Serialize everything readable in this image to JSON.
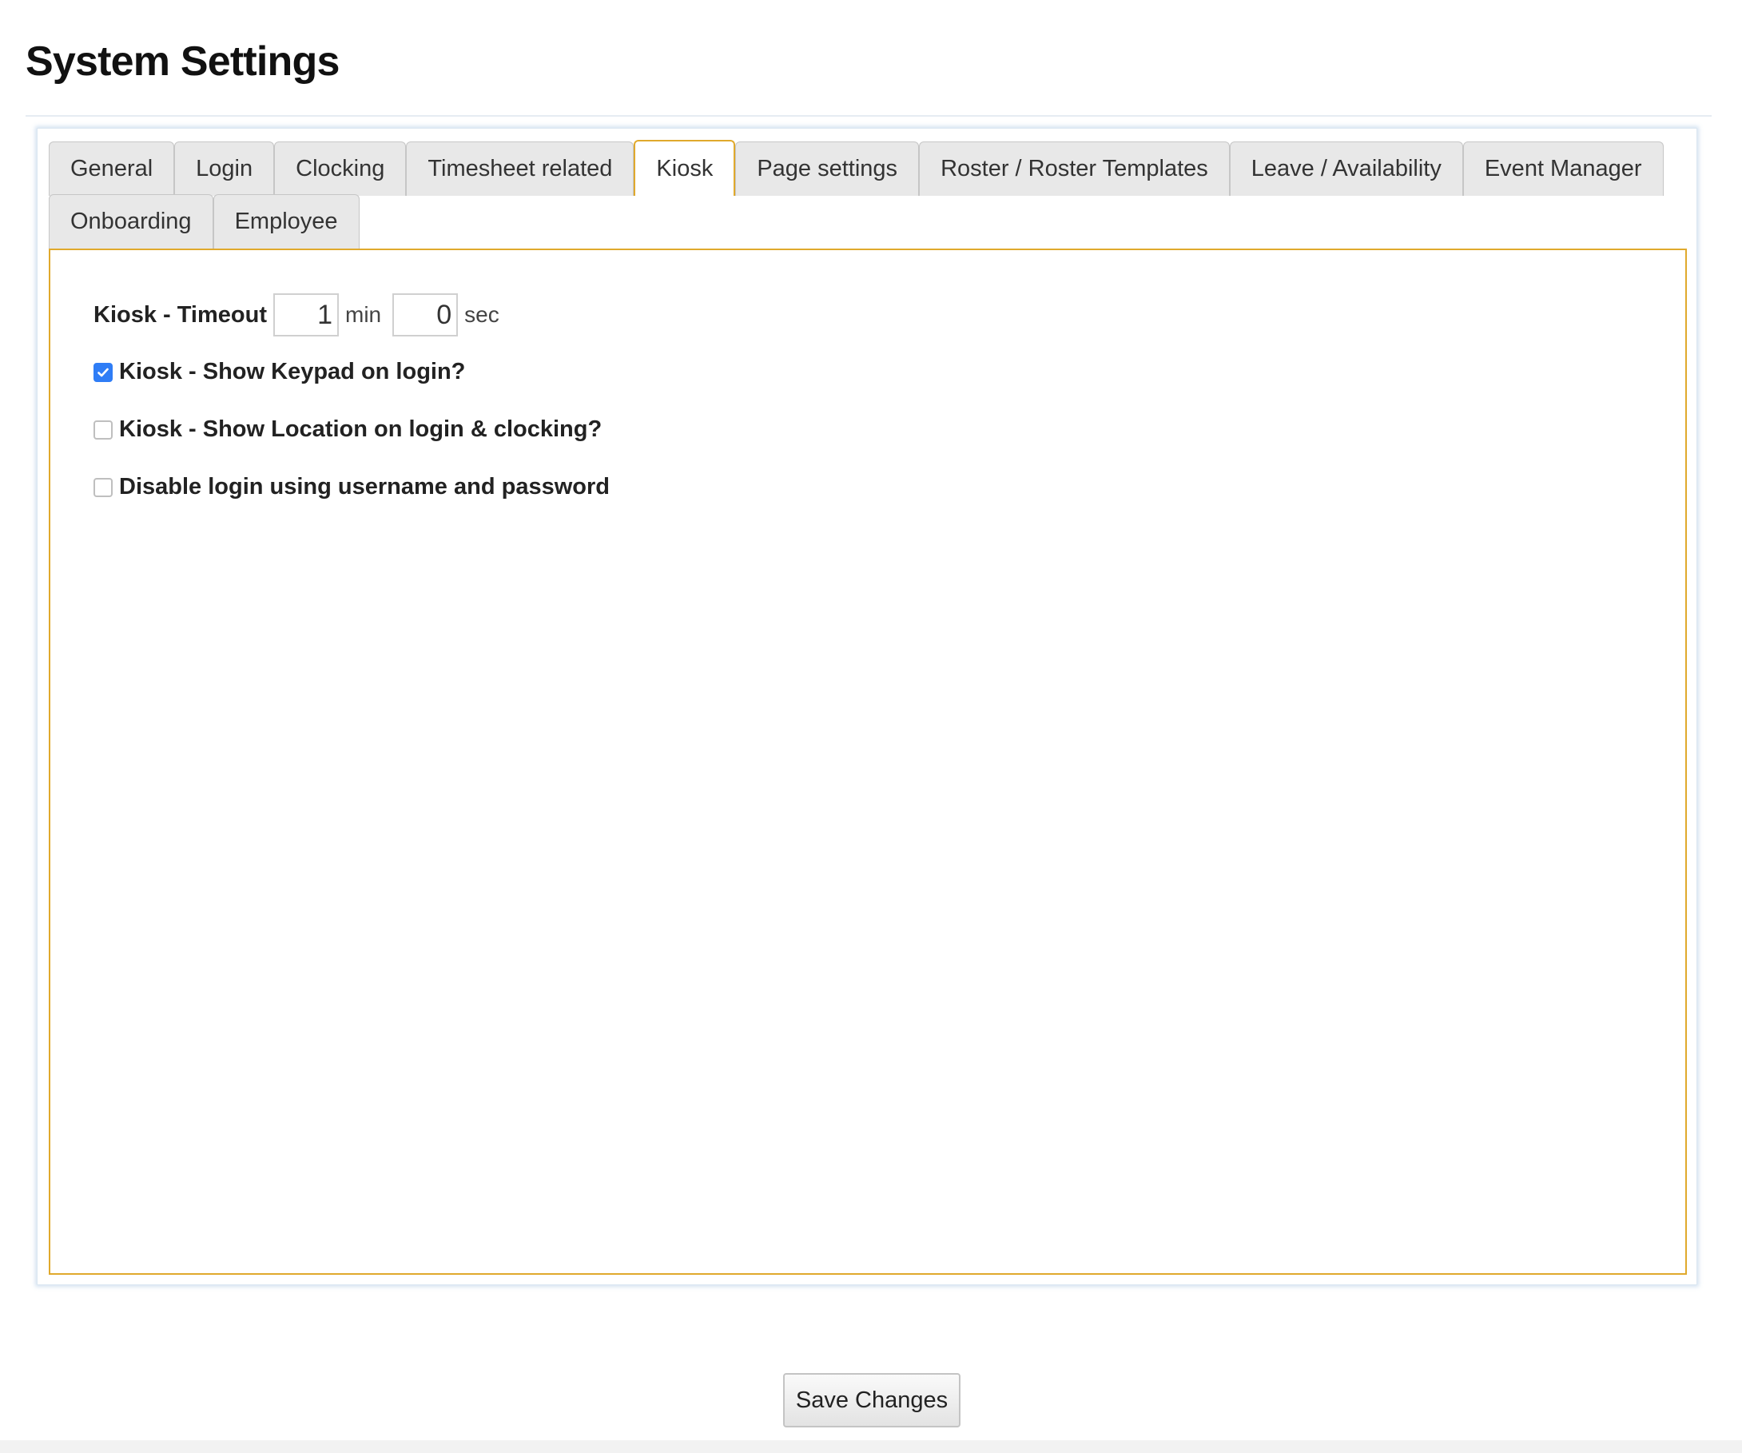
{
  "page": {
    "title": "System Settings"
  },
  "tabs": {
    "row1": [
      {
        "label": "General",
        "active": false
      },
      {
        "label": "Login",
        "active": false
      },
      {
        "label": "Clocking",
        "active": false
      },
      {
        "label": "Timesheet related",
        "active": false
      },
      {
        "label": "Kiosk",
        "active": true
      },
      {
        "label": "Page settings",
        "active": false
      },
      {
        "label": "Roster / Roster Templates",
        "active": false
      },
      {
        "label": "Leave / Availability",
        "active": false
      },
      {
        "label": "Event Manager",
        "active": false
      }
    ],
    "row2": [
      {
        "label": "Onboarding",
        "active": false
      },
      {
        "label": "Employee",
        "active": false
      }
    ]
  },
  "kiosk": {
    "timeout": {
      "label": "Kiosk - Timeout",
      "minutes": "1",
      "min_unit": "min",
      "seconds": "0",
      "sec_unit": "sec"
    },
    "show_keypad": {
      "label": "Kiosk - Show Keypad on login?",
      "checked": true
    },
    "show_location": {
      "label": "Kiosk - Show Location on login & clocking?",
      "checked": false
    },
    "disable_login": {
      "label": "Disable login using username and password",
      "checked": false
    }
  },
  "actions": {
    "save_label": "Save Changes"
  },
  "colors": {
    "active_tab_border": "#e0a92c",
    "checkbox_checked": "#2f7df6",
    "panel_glow": "#9dbee0"
  }
}
